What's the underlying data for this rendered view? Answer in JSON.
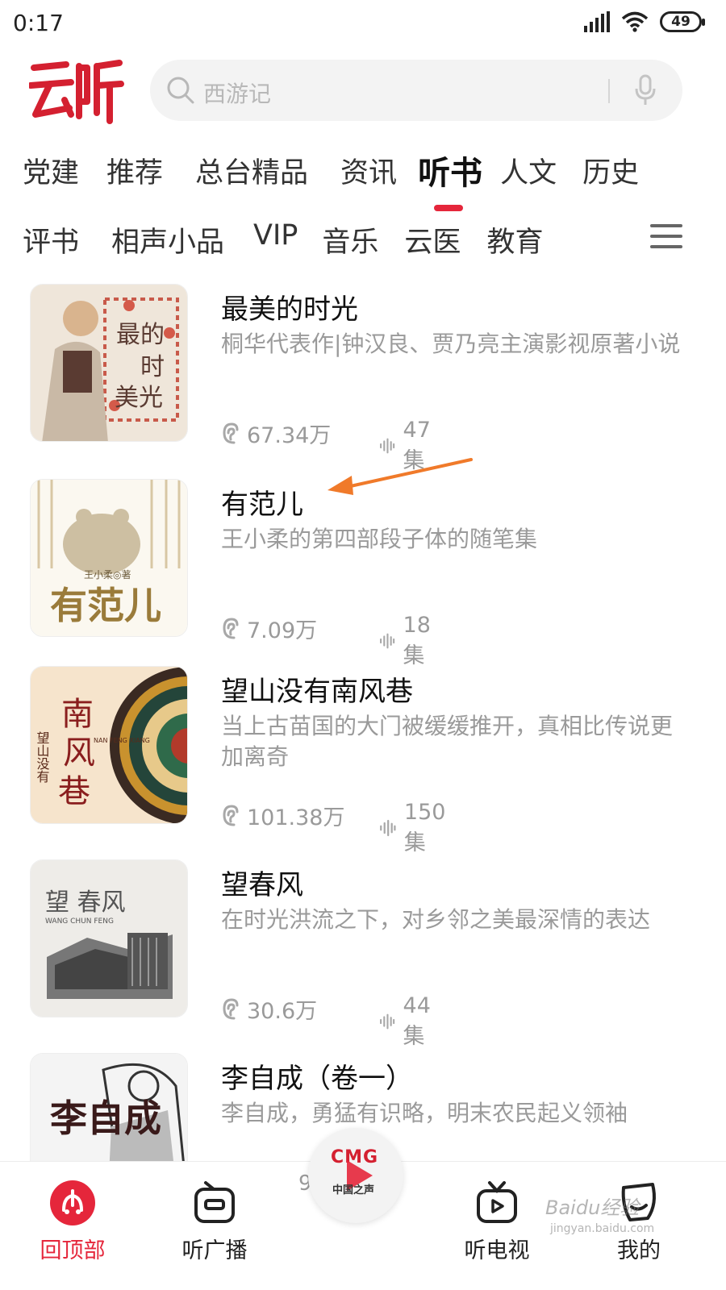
{
  "status_bar": {
    "time": "0:17",
    "battery": "49"
  },
  "search": {
    "placeholder": "西游记"
  },
  "tabs_row1": [
    {
      "label": "党建"
    },
    {
      "label": "推荐"
    },
    {
      "label": "总台精品"
    },
    {
      "label": "资讯"
    },
    {
      "label": "听书",
      "active": true
    },
    {
      "label": "人文"
    },
    {
      "label": "历史"
    }
  ],
  "tabs_row2": [
    {
      "label": "评书"
    },
    {
      "label": "相声小品"
    },
    {
      "label": "VIP"
    },
    {
      "label": "音乐"
    },
    {
      "label": "云医"
    },
    {
      "label": "教育"
    }
  ],
  "books": [
    {
      "title": "最美的时光",
      "desc": "桐华代表作|钟汉良、贾乃亮主演影视原著小说",
      "plays": "67.34万",
      "episodes": "47集",
      "cover_text": "最的时美光"
    },
    {
      "title": "有范儿",
      "desc": "王小柔的第四部段子体的随笔集",
      "plays": "7.09万",
      "episodes": "18集",
      "cover_text": "有范儿",
      "cover_author": "王小柔◎著"
    },
    {
      "title": "望山没有南风巷",
      "desc": "当上古苗国的大门被缓缓推开，真相比传说更加离奇",
      "plays": "101.38万",
      "episodes": "150集",
      "cover_text": "南风巷",
      "cover_sub": "望山没有",
      "cover_pinyin": "NAN FENG XIANG"
    },
    {
      "title": "望春风",
      "desc": "在时光洪流之下，对乡邻之美最深情的表达",
      "plays": "30.6万",
      "episodes": "44集",
      "cover_text": "望  春风",
      "cover_pinyin": "WANG   CHUN FENG"
    },
    {
      "title": "李自成（卷一）",
      "desc": "李自成，勇猛有识略，明末农民起义领袖",
      "plays": "",
      "episodes": "",
      "cover_text": "李自成"
    }
  ],
  "bottom_nav": {
    "back_to_top": "回顶部",
    "radio": "听广播",
    "center_brand": "CMG",
    "center_sub": "中国之声",
    "center_partial": "9",
    "tv": "听电视",
    "mine": "我的"
  },
  "watermark": {
    "main": "Baidu经验",
    "sub": "jingyan.baidu.com"
  },
  "colors": {
    "accent": "#e5263b",
    "annotation_arrow": "#f07a2a"
  }
}
